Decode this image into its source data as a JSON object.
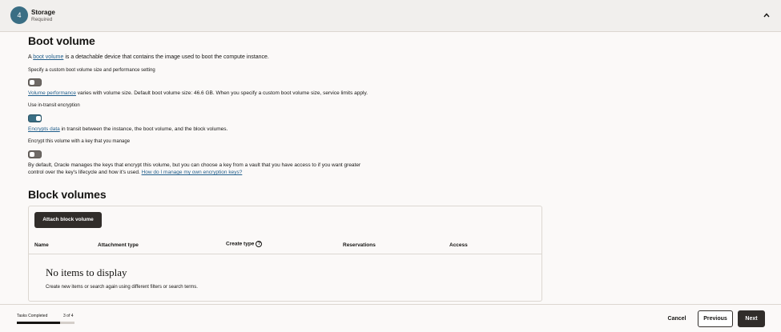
{
  "step": {
    "number": "4",
    "title": "Storage",
    "subtitle": "Required"
  },
  "boot_volume": {
    "heading": "Boot volume",
    "intro_prefix": "A ",
    "intro_link": "boot volume",
    "intro_suffix": " is a detachable device that contains the image used to boot the compute instance.",
    "custom_size": {
      "label": "Specify a custom boot volume size and performance setting",
      "enabled": false,
      "help_link": "Volume performance",
      "help_suffix": " varies with volume size. Default boot volume size: 46.6 GB. When you specify a custom boot volume size, service limits apply."
    },
    "in_transit": {
      "label": "Use in-transit encryption",
      "enabled": true,
      "help_link": "Encrypts data",
      "help_suffix": " in transit between the instance, the boot volume, and the block volumes."
    },
    "own_key": {
      "label": "Encrypt this volume with a key that you manage",
      "enabled": false,
      "help_line1": "By default, Oracle manages the keys that encrypt this volume, but you can choose a key from a vault that you have access to if you want greater",
      "help_line2": "control over the key's lifecycle and how it's used. ",
      "help_link": "How do I manage my own encryption keys?"
    }
  },
  "block_volumes": {
    "heading": "Block volumes",
    "attach_button": "Attach block volume",
    "columns": [
      "Name",
      "Attachment type",
      "Create type",
      "Reservations",
      "Access"
    ],
    "empty_title": "No items to display",
    "empty_subtitle": "Create new items or search again using different filters or search terms."
  },
  "footer": {
    "tasks_label": "Tasks Completed",
    "tasks_count": "3 of 4",
    "progress": 0.75,
    "cancel": "Cancel",
    "previous": "Previous",
    "next": "Next"
  },
  "colors": {
    "accent": "#3a6e84",
    "primary_button": "#312d2a",
    "link": "#1f5d8a"
  }
}
